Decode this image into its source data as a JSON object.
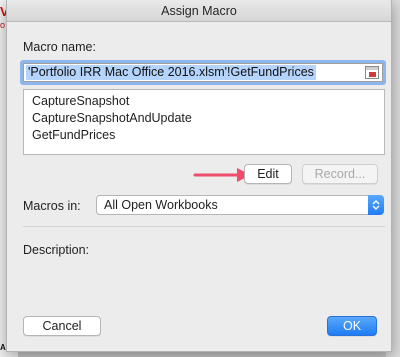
{
  "background": {
    "top_red_text": "V",
    "second_red_text": "o",
    "bottom_text": "AL CURRENT FUND PRICE"
  },
  "dialog": {
    "title": "Assign Macro",
    "macro_name_label": "Macro name:",
    "macro_name_value": "'Portfolio IRR Mac Office 2016.xlsm'!GetFundPrices",
    "macro_list": [
      "CaptureSnapshot",
      "CaptureSnapshotAndUpdate",
      "GetFundPrices"
    ],
    "edit_label": "Edit",
    "record_label": "Record...",
    "macros_in_label": "Macros in:",
    "macros_in_value": "All Open Workbooks",
    "description_label": "Description:",
    "cancel_label": "Cancel",
    "ok_label": "OK"
  },
  "colors": {
    "accent": "#1e7cf5",
    "selection": "#b4d4fb",
    "arrow": "#ee4d6c"
  },
  "icons": {
    "reference": "cell-reference-icon",
    "stepper": "up-down-chevron-icon",
    "arrow": "pointer-arrow-icon"
  }
}
